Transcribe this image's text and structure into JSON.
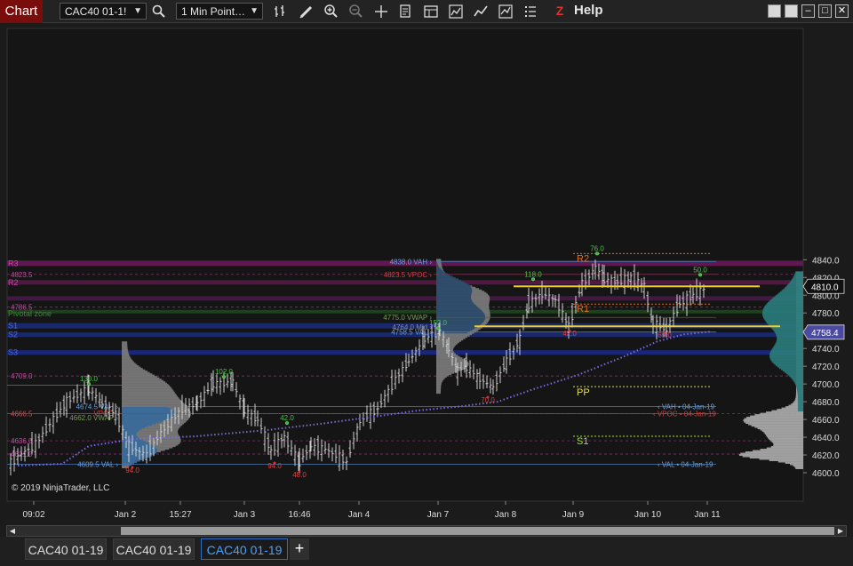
{
  "toolbar": {
    "chart_tab": "Chart",
    "instrument": "CAC40 01-1!",
    "interval": "1 Min Point…",
    "help": "Help"
  },
  "chart": {
    "copyright": "© 2019 NinjaTrader, LLC",
    "y_ticks": [
      "4840.0",
      "4820.0",
      "4800.0",
      "4780.0",
      "4760.0",
      "4740.0",
      "4720.0",
      "4700.0",
      "4680.0",
      "4660.0",
      "4640.0",
      "4620.0",
      "4600.0"
    ],
    "x_ticks": [
      "09:02",
      "Jan 2",
      "15:27",
      "Jan 3",
      "16:46",
      "Jan 4",
      "Jan 7",
      "Jan 8",
      "Jan 9",
      "Jan 10",
      "Jan 11"
    ],
    "current_price": "4810.0",
    "vwap_price": "4758.4",
    "pivots": {
      "r2": "R2",
      "r1": "R1",
      "pp": "PP",
      "s1": "S1",
      "pivot_zone": "Pivotal zone",
      "r3_left": "R3",
      "r2_left": "R2",
      "s1_left": "S1",
      "s2_left": "S2",
      "s3_left": "S3"
    },
    "left_labels": [
      "4823.5",
      "4786.5",
      "4709.0",
      "4666.5",
      "4636.0",
      "4621.0"
    ],
    "profile_labels": {
      "vah": "4838.0 VAH",
      "vpoc": "4823.5 VPOC",
      "vwap": "4775.0 VWAP",
      "mid": "4764.0 Mid",
      "val": "4758.5 VAL",
      "vah_jan4": "VAH • 04-Jan-19",
      "vpoc_jan4": "VPOC • 04-Jan-19",
      "val_jan4": "VAL • 04-Jan-19",
      "vah2": "4674.5 VAH",
      "vwap2": "4662.0 VWAP",
      "val2": "4609.5 VAL",
      "vpoc2": "VPOC"
    },
    "green_marks": [
      "130.0",
      "102.0",
      "42.0",
      "152.0",
      "118.0",
      "76.0",
      "50.0"
    ],
    "red_marks": [
      "94.0",
      "94.0",
      "48.0",
      "70.0",
      "42.0",
      "60.0"
    ]
  },
  "tabs": [
    "CAC40 01-19",
    "CAC40 01-19",
    "CAC40 01-19"
  ],
  "colors": {
    "accent": "#4aa0ff",
    "chart_tab": "#7a0c0c",
    "yellow": "#f0d020"
  }
}
